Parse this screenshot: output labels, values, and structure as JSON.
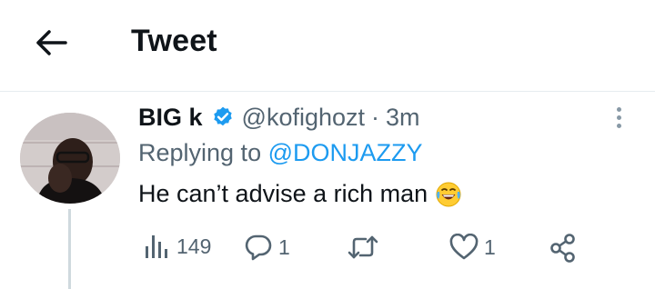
{
  "header": {
    "title": "Tweet"
  },
  "tweet": {
    "author_name": "BIG k",
    "handle": "@kofighozt",
    "separator": "·",
    "time": "3m",
    "replying_prefix": "Replying to ",
    "replying_to": "@DONJAZZY",
    "text": "He can’t advise a rich man",
    "emoji": "😂"
  },
  "actions": {
    "views": "149",
    "replies": "1",
    "retweets": "",
    "likes": "1"
  },
  "colors": {
    "accent": "#1d9bf0",
    "secondary_text": "#536471",
    "primary_text": "#0f1419",
    "divider": "#e6ecf0"
  }
}
